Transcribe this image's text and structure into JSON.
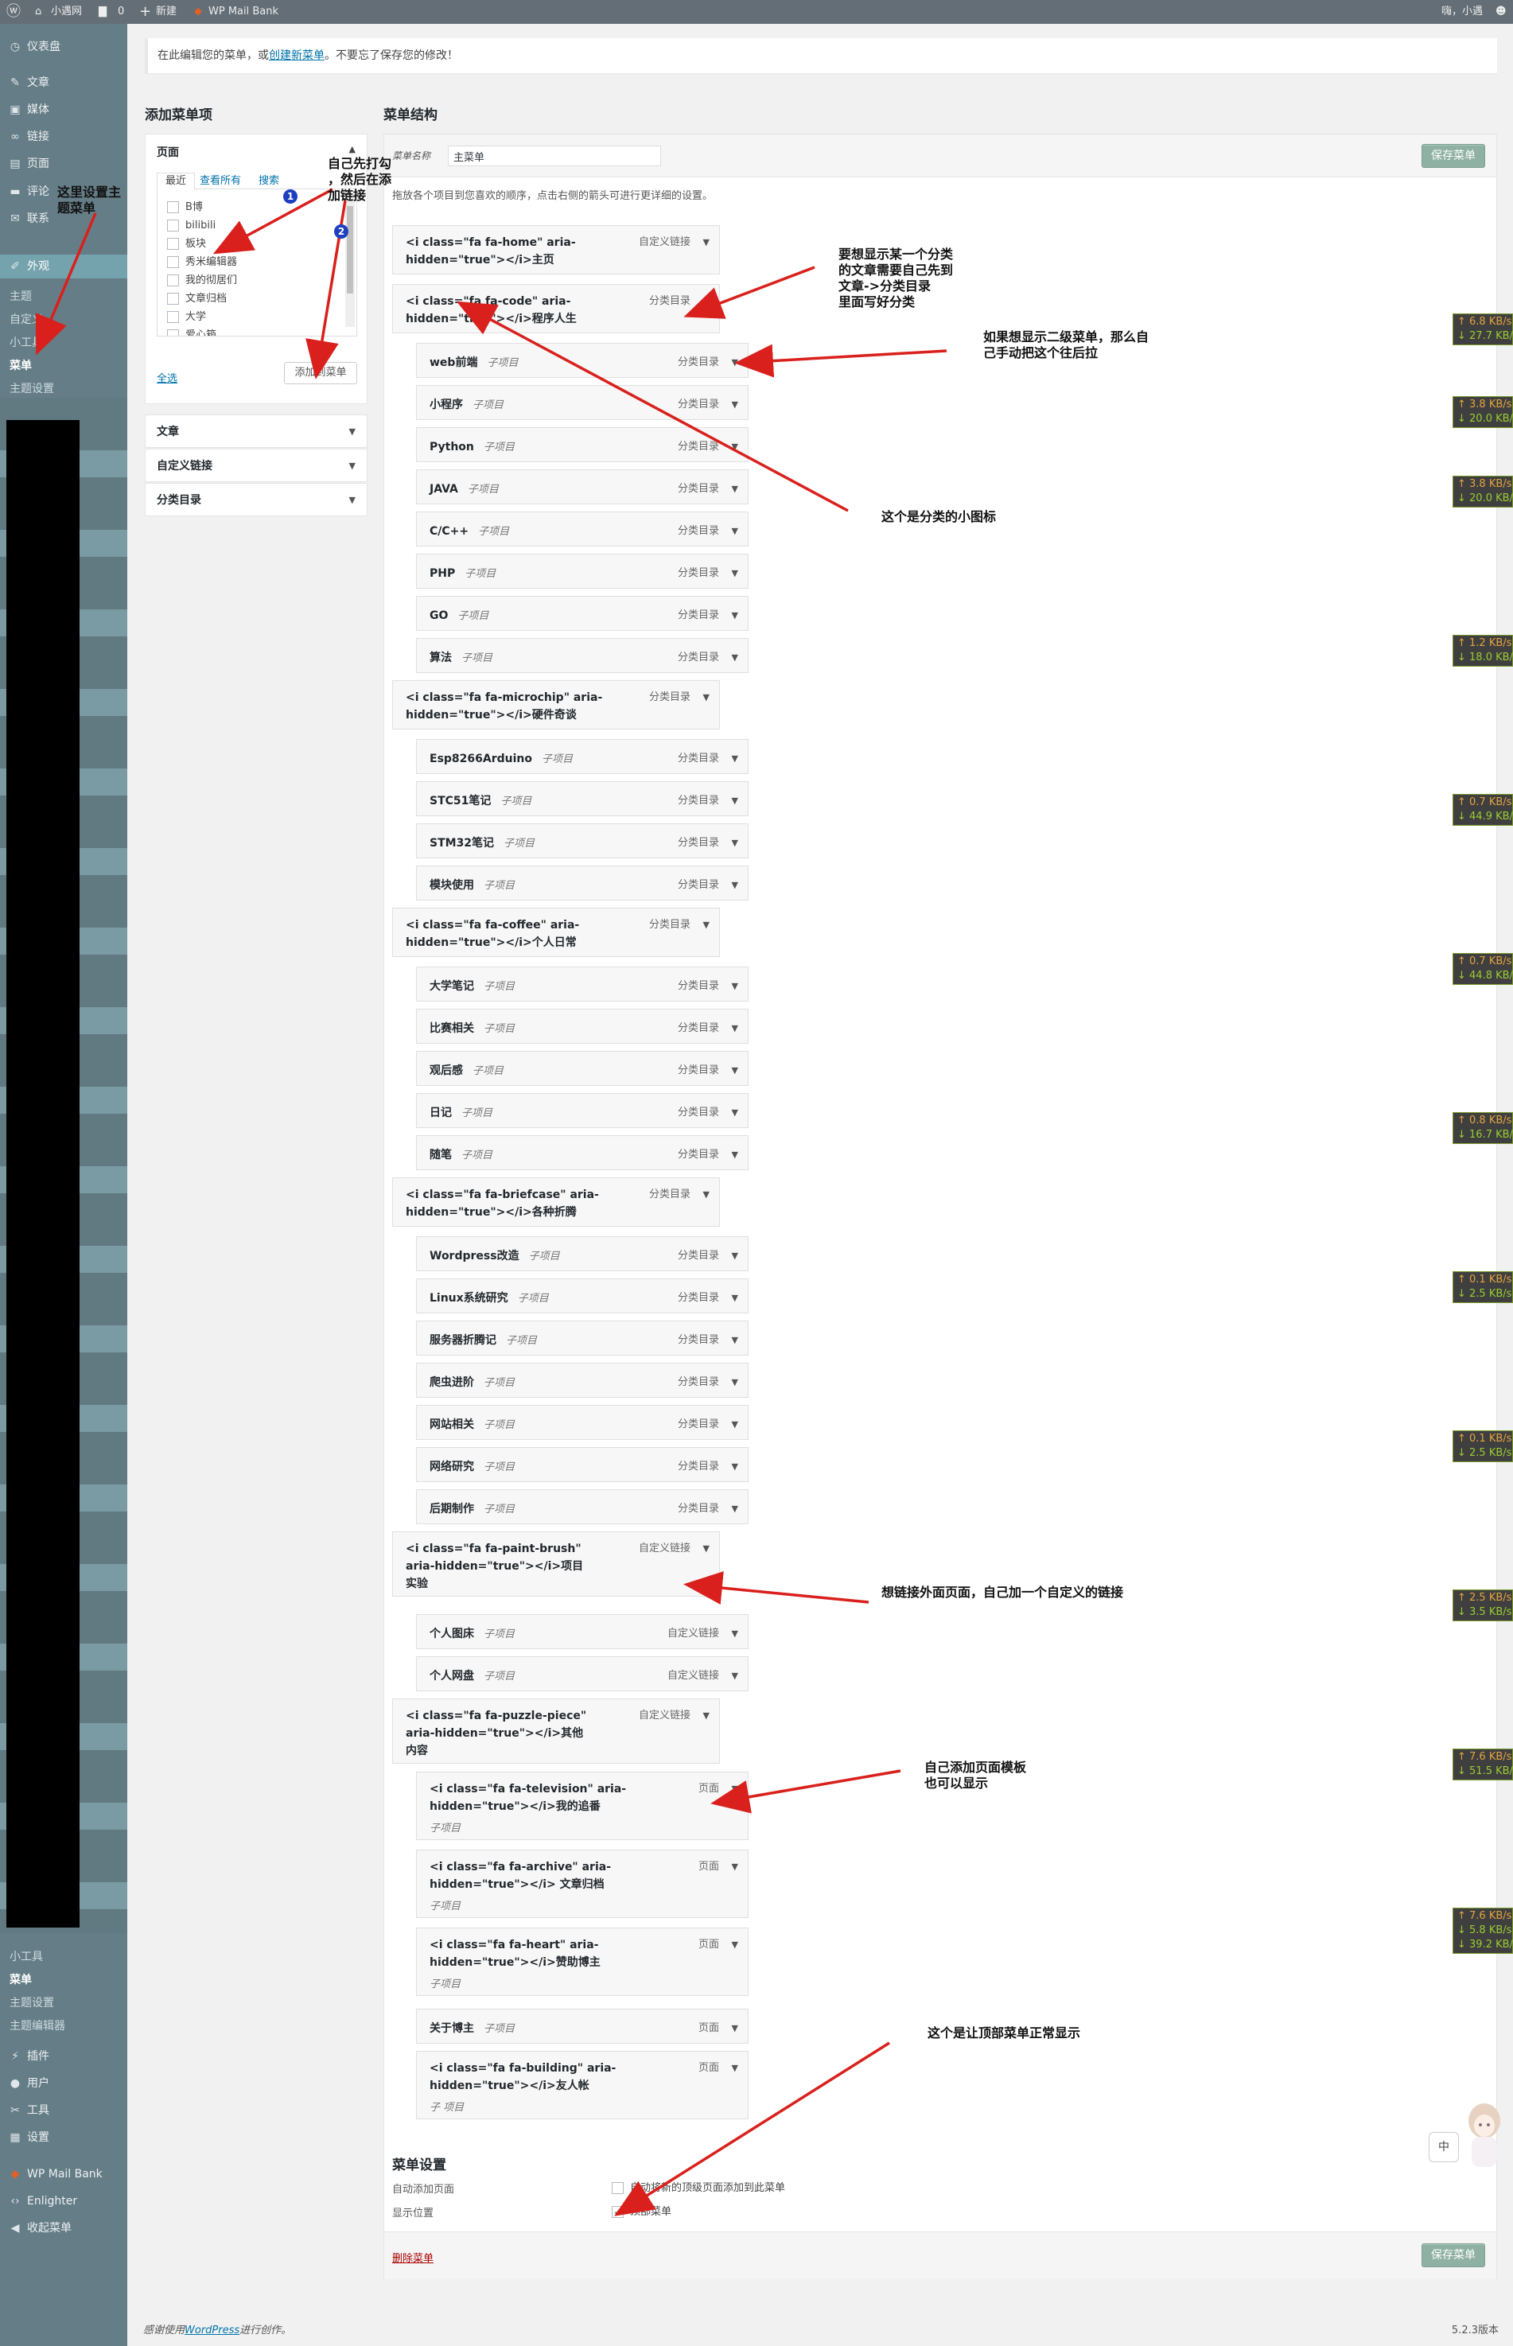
{
  "adminbar": {
    "site": "小遇网",
    "comments": "0",
    "new": "新建",
    "plugin": "WP Mail Bank",
    "greeting": "嗨，小遇"
  },
  "sidebar": {
    "top_items": [
      {
        "label": "仪表盘",
        "icon": "dashboard-icon"
      },
      {
        "label": "文章",
        "icon": "pin-icon"
      },
      {
        "label": "媒体",
        "icon": "media-icon"
      },
      {
        "label": "链接",
        "icon": "link-icon"
      },
      {
        "label": "页面",
        "icon": "page-icon"
      },
      {
        "label": "评论",
        "icon": "comment-icon"
      },
      {
        "label": "联系",
        "icon": "mail-icon"
      },
      {
        "label": "外观",
        "icon": "brush-icon"
      }
    ],
    "appearance_sub": [
      "主题",
      "自定义",
      "小工具",
      "菜单",
      "主题设置"
    ],
    "lower_sub": [
      "小工具",
      "菜单",
      "主题设置",
      "主题编辑器"
    ],
    "bottom_items": [
      {
        "label": "插件",
        "icon": "plugin-icon"
      },
      {
        "label": "用户",
        "icon": "user-icon"
      },
      {
        "label": "工具",
        "icon": "wrench-icon"
      },
      {
        "label": "设置",
        "icon": "settings-icon"
      },
      {
        "label": "WP Mail Bank",
        "icon": "mail-bank-icon"
      },
      {
        "label": "Enlighter",
        "icon": "code-icon"
      },
      {
        "label": "收起菜单",
        "icon": "collapse-icon"
      }
    ]
  },
  "notice": {
    "before": "在此编辑您的菜单，或",
    "link": "创建新菜单",
    "after": "。不要忘了保存您的修改！"
  },
  "add_items": {
    "heading": "添加菜单项",
    "pages": {
      "title": "页面",
      "tabs": [
        "最近",
        "查看所有",
        "搜索"
      ],
      "items": [
        "B博",
        "bilibili",
        "板块",
        "秀米编辑器",
        "我的彻居们",
        "文章归档",
        "大学",
        "爱心箱"
      ],
      "select_all": "全选",
      "add_button": "添加到菜单"
    },
    "collapsed": [
      "文章",
      "自定义链接",
      "分类目录"
    ]
  },
  "structure": {
    "heading": "菜单结构",
    "name_label": "菜单名称",
    "name_value": "主菜单",
    "save": "保存菜单",
    "instructions": "拖放各个项目到您喜欢的顺序，点击右侧的箭头可进行更详细的设置。",
    "items": [
      {
        "title": "<i class=\"fa fa-home\" aria-\nhidden=\"true\"></i>主页",
        "sub": "",
        "type": "自定义链接",
        "depth": 0
      },
      {
        "title": "<i class=\"fa fa-code\" aria-\nhidden=\"true\"></i>程序人生",
        "sub": "",
        "type": "分类目录",
        "depth": 0
      },
      {
        "title": "web前端",
        "sub": "子项目",
        "type": "分类目录",
        "depth": 1
      },
      {
        "title": "小程序",
        "sub": "子项目",
        "type": "分类目录",
        "depth": 1
      },
      {
        "title": "Python",
        "sub": "子项目",
        "type": "分类目录",
        "depth": 1
      },
      {
        "title": "JAVA",
        "sub": "子项目",
        "type": "分类目录",
        "depth": 1
      },
      {
        "title": "C/C++",
        "sub": "子项目",
        "type": "分类目录",
        "depth": 1
      },
      {
        "title": "PHP",
        "sub": "子项目",
        "type": "分类目录",
        "depth": 1
      },
      {
        "title": "GO",
        "sub": "子项目",
        "type": "分类目录",
        "depth": 1
      },
      {
        "title": "算法",
        "sub": "子项目",
        "type": "分类目录",
        "depth": 1
      },
      {
        "title": "<i class=\"fa fa-microchip\" aria-\nhidden=\"true\"></i>硬件奇谈",
        "sub": "",
        "type": "分类目录",
        "depth": 0
      },
      {
        "title": "Esp8266Arduino",
        "sub": "子项目",
        "type": "分类目录",
        "depth": 1
      },
      {
        "title": "STC51笔记",
        "sub": "子项目",
        "type": "分类目录",
        "depth": 1
      },
      {
        "title": "STM32笔记",
        "sub": "子项目",
        "type": "分类目录",
        "depth": 1
      },
      {
        "title": "模块使用",
        "sub": "子项目",
        "type": "分类目录",
        "depth": 1
      },
      {
        "title": "<i class=\"fa fa-coffee\" aria-\nhidden=\"true\"></i>个人日常",
        "sub": "",
        "type": "分类目录",
        "depth": 0
      },
      {
        "title": "大学笔记",
        "sub": "子项目",
        "type": "分类目录",
        "depth": 1
      },
      {
        "title": "比赛相关",
        "sub": "子项目",
        "type": "分类目录",
        "depth": 1
      },
      {
        "title": "观后感",
        "sub": "子项目",
        "type": "分类目录",
        "depth": 1
      },
      {
        "title": "日记",
        "sub": "子项目",
        "type": "分类目录",
        "depth": 1
      },
      {
        "title": "随笔",
        "sub": "子项目",
        "type": "分类目录",
        "depth": 1
      },
      {
        "title": "<i class=\"fa fa-briefcase\" aria-\nhidden=\"true\"></i>各种折腾",
        "sub": "",
        "type": "分类目录",
        "depth": 0
      },
      {
        "title": "Wordpress改造",
        "sub": "子项目",
        "type": "分类目录",
        "depth": 1
      },
      {
        "title": "Linux系统研究",
        "sub": "子项目",
        "type": "分类目录",
        "depth": 1
      },
      {
        "title": "服务器折腾记",
        "sub": "子项目",
        "type": "分类目录",
        "depth": 1
      },
      {
        "title": "爬虫进阶",
        "sub": "子项目",
        "type": "分类目录",
        "depth": 1
      },
      {
        "title": "网站相关",
        "sub": "子项目",
        "type": "分类目录",
        "depth": 1
      },
      {
        "title": "网络研究",
        "sub": "子项目",
        "type": "分类目录",
        "depth": 1
      },
      {
        "title": "后期制作",
        "sub": "子项目",
        "type": "分类目录",
        "depth": 1
      },
      {
        "title": "<i class=\"fa fa-paint-brush\"\naria-hidden=\"true\"></i>项目\n实验",
        "sub": "",
        "type": "自定义链接",
        "depth": 0
      },
      {
        "title": "个人图床",
        "sub": "子项目",
        "type": "自定义链接",
        "depth": 1
      },
      {
        "title": "个人网盘",
        "sub": "子项目",
        "type": "自定义链接",
        "depth": 1
      },
      {
        "title": "<i class=\"fa fa-puzzle-piece\"\naria-hidden=\"true\"></i>其他\n内容",
        "sub": "",
        "type": "自定义链接",
        "depth": 0
      },
      {
        "title": "<i class=\"fa fa-television\" aria-\nhidden=\"true\"></i>我的追番",
        "sub": "子项目",
        "type": "页面",
        "depth": 1
      },
      {
        "title": "<i class=\"fa fa-archive\" aria-\nhidden=\"true\"></i> 文章归档",
        "sub": "子项目",
        "type": "页面",
        "depth": 1
      },
      {
        "title": "<i class=\"fa fa-heart\" aria-\nhidden=\"true\"></i>赞助博主",
        "sub": "子项目",
        "type": "页面",
        "depth": 1
      },
      {
        "title": "关于博主",
        "sub": "子项目",
        "type": "页面",
        "depth": 1
      },
      {
        "title": "<i class=\"fa fa-building\" aria-\nhidden=\"true\"></i>友人帐",
        "sub": "子\n项目",
        "type": "页面",
        "depth": 1
      }
    ],
    "settings": {
      "heading": "菜单设置",
      "auto_label": "自动添加页面",
      "auto_text": "自动将新的顶级页面添加到此菜单",
      "pos_label": "显示位置",
      "pos_text": "顶部菜单"
    },
    "delete": "删除菜单"
  },
  "annotations": [
    "这里设置主\n题菜单",
    "自己先打勾\n，然后在添\n加链接",
    "要想显示某一个分类\n的文章需要自己先到\n文章->分类目录\n里面写好分类",
    "如果想显示二级菜单，那么自\n己手动把这个往后拉",
    "这个是分类的小图标",
    "想链接外面页面，自己加一个自定义的链接",
    "自己添加页面模板\n也可以显示",
    "这个是让顶部菜单正常显示"
  ],
  "markers": [
    "1",
    "2"
  ],
  "speed": [
    {
      "up": "↑ 6.8 KB/s",
      "dn": "↓ 27.7 KB/s"
    },
    {
      "up": "↑ 3.8 KB/s",
      "dn": "↓ 20.0 KB/s"
    },
    {
      "up": "↑ 3.8 KB/s",
      "dn": "↓ 20.0 KB/s"
    },
    {
      "up": "↑ 1.2 KB/s",
      "dn": "↓ 18.0 KB/s"
    },
    {
      "up": "↑ 0.7 KB/s",
      "dn": "↓ 44.9 KB/s"
    },
    {
      "up": "↑ 0.7 KB/s",
      "dn": "↓ 44.8 KB/s"
    },
    {
      "up": "↑ 0.8 KB/s",
      "dn": "↓ 16.7 KB/s"
    },
    {
      "up": "↑ 0.1 KB/s",
      "dn": "↓ 2.5 KB/s"
    },
    {
      "up": "↑ 0.1 KB/s",
      "dn": "↓ 2.5 KB/s"
    },
    {
      "up": "↑ 2.5 KB/s",
      "dn": "↓ 3.5 KB/s"
    },
    {
      "up": "↑ 7.6 KB/s",
      "dn": "↓ 51.5 KB/s"
    },
    {
      "up": "↑ 7.6 KB/s",
      "dn": "↓ 5.8 KB/s"
    }
  ],
  "speed_extra": "↓ 39.2 KB/s",
  "ime": "中",
  "footer": {
    "before": "感谢使用",
    "link": "WordPress",
    "after": "进行创作。",
    "version": "5.2.3版本"
  }
}
